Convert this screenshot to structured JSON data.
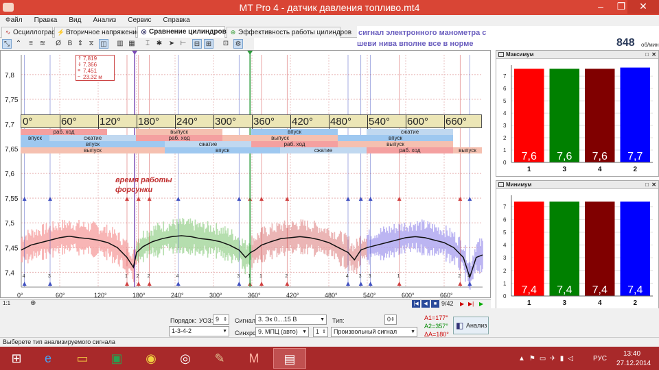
{
  "window": {
    "title": "MT Pro 4 - датчик давления топливо.mt4"
  },
  "menu": [
    "Файл",
    "Правка",
    "Вид",
    "Анализ",
    "Сервис",
    "Справка"
  ],
  "tabs": [
    {
      "label": "Осциллограф",
      "icon": "wave-icon"
    },
    {
      "label": "Вторичное напряжение",
      "icon": "secondary-icon"
    },
    {
      "label": "Сравнение цилиндров",
      "icon": "compare-icon"
    },
    {
      "label": "Эффективность работы цилиндров",
      "icon": "efficiency-icon"
    }
  ],
  "note": {
    "line1": "сигнал электронного манометра с",
    "line2": "шеви нива вполне все в норме"
  },
  "rpm": {
    "value": "848",
    "unit": "об/мин"
  },
  "tooltip": {
    "l1": "7,819",
    "l2": "7,366",
    "l3": "7,451",
    "l4": "23,32 м"
  },
  "annotation": {
    "l1": "время работы",
    "l2": "форсунки"
  },
  "chart_data": {
    "type": "line",
    "yaxis": {
      "ticks": [
        "7,8",
        "7,75",
        "7,7",
        "7,65",
        "7,6",
        "7,55",
        "7,5",
        "7,45",
        "7,4"
      ],
      "ylim": [
        7.37,
        7.84
      ]
    },
    "xaxis": {
      "ticks": [
        "0°",
        "60°",
        "120°",
        "180°",
        "240°",
        "300°",
        "360°",
        "420°",
        "480°",
        "540°",
        "600°",
        "660°"
      ],
      "xlim": [
        0,
        720
      ]
    },
    "degree_labels": [
      "0°",
      "60°",
      "120°",
      "180°",
      "240°",
      "300°",
      "360°",
      "420°",
      "480°",
      "540°",
      "600°",
      "660°"
    ],
    "phase_rows": [
      {
        "name": "",
        "segments": [
          {
            "label": "раб. ход",
            "from": 0,
            "to": 135,
            "color": "#f4a0a0"
          },
          {
            "label": "выпуск",
            "from": 180,
            "to": 315,
            "color": "#f5c0b0"
          },
          {
            "label": "впуск",
            "from": 360,
            "to": 495,
            "color": "#9ec8f0"
          },
          {
            "label": "сжатие",
            "from": 540,
            "to": 675,
            "color": "#c0d8f0"
          }
        ]
      },
      {
        "name": "",
        "segments": [
          {
            "label": "впуск",
            "from": 0,
            "to": 45,
            "color": "#9ec8f0"
          },
          {
            "label": "сжатие",
            "from": 45,
            "to": 180,
            "color": "#c0d8f0"
          },
          {
            "label": "раб. ход",
            "from": 180,
            "to": 315,
            "color": "#f4a0a0"
          },
          {
            "label": "выпуск",
            "from": 315,
            "to": 495,
            "color": "#f5c0b0"
          },
          {
            "label": "впуск",
            "from": 495,
            "to": 675,
            "color": "#9ec8f0"
          }
        ]
      },
      {
        "name": "",
        "segments": [
          {
            "label": "впуск",
            "from": 0,
            "to": 225,
            "color": "#9ec8f0"
          },
          {
            "label": "сжатие",
            "from": 225,
            "to": 360,
            "color": "#c0d8f0"
          },
          {
            "label": "раб. ход",
            "from": 360,
            "to": 495,
            "color": "#f4a0a0"
          },
          {
            "label": "выпуск",
            "from": 495,
            "to": 675,
            "color": "#f5c0b0"
          }
        ]
      },
      {
        "name": "",
        "segments": [
          {
            "label": "выпуск",
            "from": 0,
            "to": 225,
            "color": "#f5c0b0"
          },
          {
            "label": "впуск",
            "from": 225,
            "to": 405,
            "color": "#9ec8f0"
          },
          {
            "label": "сжатие",
            "from": 405,
            "to": 540,
            "color": "#c0d8f0"
          },
          {
            "label": "раб. ход",
            "from": 540,
            "to": 675,
            "color": "#f4a0a0"
          },
          {
            "label": "выпуск",
            "from": 675,
            "to": 720,
            "color": "#f5c0b0"
          }
        ]
      }
    ],
    "cylinder_markers": [
      {
        "label": "4",
        "x": 5
      },
      {
        "label": "3",
        "x": 45
      },
      {
        "label": "1",
        "x": 165
      },
      {
        "label": "2",
        "x": 183
      },
      {
        "label": "2",
        "x": 200
      },
      {
        "label": "4",
        "x": 245
      },
      {
        "label": "3",
        "x": 340
      },
      {
        "label": "1",
        "x": 357
      },
      {
        "label": "1",
        "x": 375
      },
      {
        "label": "2",
        "x": 415
      },
      {
        "label": "4",
        "x": 510
      },
      {
        "label": "3",
        "x": 530
      },
      {
        "label": "3",
        "x": 545
      },
      {
        "label": "1",
        "x": 590
      },
      {
        "label": "2",
        "x": 685
      },
      {
        "label": "4",
        "x": 700
      }
    ],
    "background_segments": [
      {
        "from": 0,
        "to": 180,
        "color": "#f7a8a8"
      },
      {
        "from": 180,
        "to": 360,
        "color": "#a8d8a0"
      },
      {
        "from": 360,
        "to": 540,
        "color": "#e8a8a8"
      },
      {
        "from": 540,
        "to": 720,
        "color": "#b0a8f0"
      }
    ],
    "series": [
      {
        "x": [
          0,
          15,
          30,
          45,
          60,
          75,
          90,
          105,
          120,
          135,
          150,
          165,
          175,
          180,
          190,
          205,
          220,
          235,
          250,
          265,
          280,
          295,
          310,
          325,
          340,
          350,
          358,
          365,
          375,
          390,
          405,
          420,
          435,
          450,
          465,
          480,
          495,
          510,
          520,
          530,
          540,
          555,
          570,
          585,
          600,
          615,
          630,
          645,
          660,
          675,
          690,
          700,
          710,
          720
        ],
        "y": [
          7.445,
          7.455,
          7.46,
          7.465,
          7.47,
          7.473,
          7.47,
          7.468,
          7.465,
          7.46,
          7.45,
          7.43,
          7.41,
          7.44,
          7.452,
          7.462,
          7.468,
          7.472,
          7.474,
          7.472,
          7.468,
          7.466,
          7.462,
          7.455,
          7.445,
          7.43,
          7.44,
          7.445,
          7.455,
          7.462,
          7.468,
          7.47,
          7.472,
          7.47,
          7.466,
          7.46,
          7.45,
          7.44,
          7.425,
          7.445,
          7.45,
          7.455,
          7.46,
          7.465,
          7.47,
          7.472,
          7.47,
          7.465,
          7.46,
          7.45,
          7.43,
          7.39,
          7.43,
          7.435
        ]
      }
    ]
  },
  "pager": {
    "text": "9/42"
  },
  "statusbar": {
    "text": "Выберете тип анализируемого сигнала"
  },
  "form": {
    "order_label": "Порядок:",
    "order_value": "1-3-4-2",
    "uoz_label": "УОЗ:",
    "uoz_value": "9",
    "signal_label": "Сигнал:",
    "signal_value": "3. Эк 0....15 В",
    "sync_label": "Синхро:",
    "sync_value": "9. МПЦ (авто)",
    "sync_num": "1",
    "type_label": "Тип:",
    "type_num": "0",
    "type_value": "Произвольный сигнал",
    "a1": "A1=177°",
    "a2": "A2=357°",
    "da": "ΔA=180°",
    "analyze_button": "Анализ"
  },
  "panels": {
    "max": {
      "title": "Максимум",
      "yticks": [
        "7",
        "6",
        "5",
        "4",
        "3",
        "2",
        "1",
        "0"
      ]
    },
    "min": {
      "title": "Минимум",
      "yticks": [
        "7",
        "6",
        "5",
        "4",
        "3",
        "2",
        "1",
        "0"
      ]
    }
  },
  "bar_charts": [
    {
      "type": "bar",
      "title": "Максимум",
      "categories": [
        "1",
        "3",
        "4",
        "2"
      ],
      "values": [
        7.6,
        7.6,
        7.6,
        7.7
      ],
      "labels": [
        "7,6",
        "7,6",
        "7,6",
        "7,7"
      ],
      "colors": [
        "#ff0000",
        "#008000",
        "#800000",
        "#0000ff"
      ],
      "ylim": [
        0,
        7.9
      ]
    },
    {
      "type": "bar",
      "title": "Минимум",
      "categories": [
        "1",
        "3",
        "4",
        "2"
      ],
      "values": [
        7.4,
        7.4,
        7.4,
        7.4
      ],
      "labels": [
        "7,4",
        "7,4",
        "7,4",
        "7,4"
      ],
      "colors": [
        "#ff0000",
        "#008000",
        "#800000",
        "#0000ff"
      ],
      "ylim": [
        0,
        7.9
      ]
    }
  ],
  "tray": {
    "lang": "РУС",
    "time": "13:40",
    "date": "27.12.2014"
  }
}
